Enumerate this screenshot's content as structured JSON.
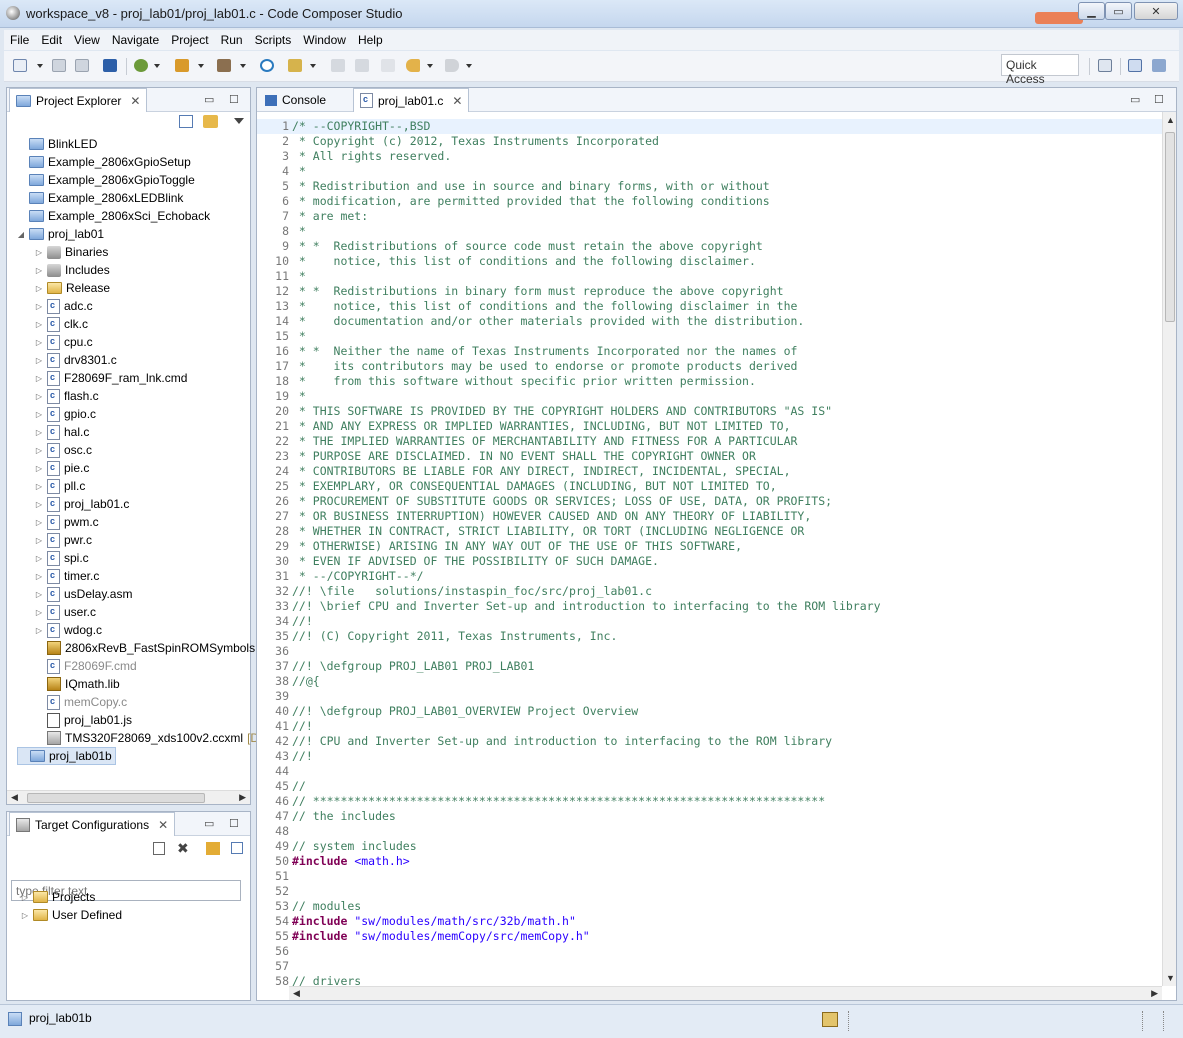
{
  "window": {
    "title": "workspace_v8 - proj_lab01/proj_lab01.c - Code Composer Studio"
  },
  "menubar": [
    "File",
    "Edit",
    "View",
    "Navigate",
    "Project",
    "Run",
    "Scripts",
    "Window",
    "Help"
  ],
  "toolbar": {
    "quick_access": "Quick Access"
  },
  "project_explorer": {
    "tab_label": "Project Explorer",
    "items": [
      {
        "label": "BlinkLED",
        "kind": "project",
        "level": 0,
        "expand": "",
        "extra": ""
      },
      {
        "label": "Example_2806xGpioSetup",
        "kind": "project",
        "level": 0,
        "expand": "",
        "extra": ""
      },
      {
        "label": "Example_2806xGpioToggle",
        "kind": "project",
        "level": 0,
        "expand": "",
        "extra": ""
      },
      {
        "label": "Example_2806xLEDBlink",
        "kind": "project",
        "level": 0,
        "expand": "",
        "extra": ""
      },
      {
        "label": "Example_2806xSci_Echoback",
        "kind": "project",
        "level": 0,
        "expand": "",
        "extra": ""
      },
      {
        "label": "proj_lab01",
        "kind": "project-open",
        "level": 0,
        "expand": "◢",
        "extra": ""
      },
      {
        "label": "Binaries",
        "kind": "binaries",
        "level": 1,
        "expand": "▷",
        "extra": ""
      },
      {
        "label": "Includes",
        "kind": "includes",
        "level": 1,
        "expand": "▷",
        "extra": ""
      },
      {
        "label": "Release",
        "kind": "folder",
        "level": 1,
        "expand": "▷",
        "extra": ""
      },
      {
        "label": "adc.c",
        "kind": "file",
        "level": 1,
        "expand": "▷",
        "extra": ""
      },
      {
        "label": "clk.c",
        "kind": "file",
        "level": 1,
        "expand": "▷",
        "extra": ""
      },
      {
        "label": "cpu.c",
        "kind": "file",
        "level": 1,
        "expand": "▷",
        "extra": ""
      },
      {
        "label": "drv8301.c",
        "kind": "file",
        "level": 1,
        "expand": "▷",
        "extra": ""
      },
      {
        "label": "F28069F_ram_lnk.cmd",
        "kind": "file",
        "level": 1,
        "expand": "▷",
        "extra": ""
      },
      {
        "label": "flash.c",
        "kind": "file",
        "level": 1,
        "expand": "▷",
        "extra": ""
      },
      {
        "label": "gpio.c",
        "kind": "file",
        "level": 1,
        "expand": "▷",
        "extra": ""
      },
      {
        "label": "hal.c",
        "kind": "file",
        "level": 1,
        "expand": "▷",
        "extra": ""
      },
      {
        "label": "osc.c",
        "kind": "file",
        "level": 1,
        "expand": "▷",
        "extra": ""
      },
      {
        "label": "pie.c",
        "kind": "file",
        "level": 1,
        "expand": "▷",
        "extra": ""
      },
      {
        "label": "pll.c",
        "kind": "file",
        "level": 1,
        "expand": "▷",
        "extra": ""
      },
      {
        "label": "proj_lab01.c",
        "kind": "file",
        "level": 1,
        "expand": "▷",
        "extra": ""
      },
      {
        "label": "pwm.c",
        "kind": "file",
        "level": 1,
        "expand": "▷",
        "extra": ""
      },
      {
        "label": "pwr.c",
        "kind": "file",
        "level": 1,
        "expand": "▷",
        "extra": ""
      },
      {
        "label": "spi.c",
        "kind": "file",
        "level": 1,
        "expand": "▷",
        "extra": ""
      },
      {
        "label": "timer.c",
        "kind": "file",
        "level": 1,
        "expand": "▷",
        "extra": ""
      },
      {
        "label": "usDelay.asm",
        "kind": "file",
        "level": 1,
        "expand": "▷",
        "extra": ""
      },
      {
        "label": "user.c",
        "kind": "file",
        "level": 1,
        "expand": "▷",
        "extra": ""
      },
      {
        "label": "wdog.c",
        "kind": "file",
        "level": 1,
        "expand": "▷",
        "extra": ""
      },
      {
        "label": "2806xRevB_FastSpinROMSymbols.",
        "kind": "lib",
        "level": 1,
        "expand": "",
        "extra": ""
      },
      {
        "label": "F28069F.cmd",
        "kind": "file-grey",
        "level": 1,
        "expand": "",
        "extra": ""
      },
      {
        "label": "IQmath.lib",
        "kind": "lib",
        "level": 1,
        "expand": "",
        "extra": ""
      },
      {
        "label": "memCopy.c",
        "kind": "file-grey",
        "level": 1,
        "expand": "",
        "extra": ""
      },
      {
        "label": "proj_lab01.js",
        "kind": "js",
        "level": 1,
        "expand": "",
        "extra": ""
      },
      {
        "label": "TMS320F28069_xds100v2.ccxml",
        "kind": "cfg",
        "level": 1,
        "expand": "",
        "extra": "[D"
      },
      {
        "label": "proj_lab01b",
        "kind": "project",
        "level": 0,
        "expand": "",
        "extra": "",
        "selected": true
      }
    ]
  },
  "target_configurations": {
    "tab_label": "Target Configurations",
    "filter_placeholder": "type filter text",
    "items": [
      {
        "label": "Projects",
        "expand": "▷"
      },
      {
        "label": "User Defined",
        "expand": "▷"
      }
    ]
  },
  "editor": {
    "tabs": [
      {
        "label": "Console",
        "active": false
      },
      {
        "label": "proj_lab01.c",
        "active": true
      }
    ],
    "lines": [
      {
        "n": "1",
        "t": "/* --COPYRIGHT--,BSD",
        "k": "comment"
      },
      {
        "n": "2",
        "t": " * Copyright (c) 2012, Texas Instruments Incorporated",
        "k": "comment"
      },
      {
        "n": "3",
        "t": " * All rights reserved.",
        "k": "comment"
      },
      {
        "n": "4",
        "t": " *",
        "k": "comment"
      },
      {
        "n": "5",
        "t": " * Redistribution and use in source and binary forms, with or without",
        "k": "comment"
      },
      {
        "n": "6",
        "t": " * modification, are permitted provided that the following conditions",
        "k": "comment"
      },
      {
        "n": "7",
        "t": " * are met:",
        "k": "comment"
      },
      {
        "n": "8",
        "t": " *",
        "k": "comment"
      },
      {
        "n": "9",
        "t": " * *  Redistributions of source code must retain the above copyright",
        "k": "comment"
      },
      {
        "n": "10",
        "t": " *    notice, this list of conditions and the following disclaimer.",
        "k": "comment"
      },
      {
        "n": "11",
        "t": " *",
        "k": "comment"
      },
      {
        "n": "12",
        "t": " * *  Redistributions in binary form must reproduce the above copyright",
        "k": "comment"
      },
      {
        "n": "13",
        "t": " *    notice, this list of conditions and the following disclaimer in the",
        "k": "comment"
      },
      {
        "n": "14",
        "t": " *    documentation and/or other materials provided with the distribution.",
        "k": "comment"
      },
      {
        "n": "15",
        "t": " *",
        "k": "comment"
      },
      {
        "n": "16",
        "t": " * *  Neither the name of Texas Instruments Incorporated nor the names of",
        "k": "comment"
      },
      {
        "n": "17",
        "t": " *    its contributors may be used to endorse or promote products derived",
        "k": "comment"
      },
      {
        "n": "18",
        "t": " *    from this software without specific prior written permission.",
        "k": "comment"
      },
      {
        "n": "19",
        "t": " *",
        "k": "comment"
      },
      {
        "n": "20",
        "t": " * THIS SOFTWARE IS PROVIDED BY THE COPYRIGHT HOLDERS AND CONTRIBUTORS \"AS IS\"",
        "k": "comment"
      },
      {
        "n": "21",
        "t": " * AND ANY EXPRESS OR IMPLIED WARRANTIES, INCLUDING, BUT NOT LIMITED TO,",
        "k": "comment"
      },
      {
        "n": "22",
        "t": " * THE IMPLIED WARRANTIES OF MERCHANTABILITY AND FITNESS FOR A PARTICULAR",
        "k": "comment"
      },
      {
        "n": "23",
        "t": " * PURPOSE ARE DISCLAIMED. IN NO EVENT SHALL THE COPYRIGHT OWNER OR",
        "k": "comment"
      },
      {
        "n": "24",
        "t": " * CONTRIBUTORS BE LIABLE FOR ANY DIRECT, INDIRECT, INCIDENTAL, SPECIAL,",
        "k": "comment"
      },
      {
        "n": "25",
        "t": " * EXEMPLARY, OR CONSEQUENTIAL DAMAGES (INCLUDING, BUT NOT LIMITED TO,",
        "k": "comment"
      },
      {
        "n": "26",
        "t": " * PROCUREMENT OF SUBSTITUTE GOODS OR SERVICES; LOSS OF USE, DATA, OR PROFITS;",
        "k": "comment"
      },
      {
        "n": "27",
        "t": " * OR BUSINESS INTERRUPTION) HOWEVER CAUSED AND ON ANY THEORY OF LIABILITY,",
        "k": "comment"
      },
      {
        "n": "28",
        "t": " * WHETHER IN CONTRACT, STRICT LIABILITY, OR TORT (INCLUDING NEGLIGENCE OR",
        "k": "comment"
      },
      {
        "n": "29",
        "t": " * OTHERWISE) ARISING IN ANY WAY OUT OF THE USE OF THIS SOFTWARE,",
        "k": "comment"
      },
      {
        "n": "30",
        "t": " * EVEN IF ADVISED OF THE POSSIBILITY OF SUCH DAMAGE.",
        "k": "comment"
      },
      {
        "n": "31",
        "t": " * --/COPYRIGHT--*/",
        "k": "comment"
      },
      {
        "n": "32",
        "t": "//! \\file   solutions/instaspin_foc/src/proj_lab01.c",
        "k": "comment"
      },
      {
        "n": "33",
        "t": "//! \\brief CPU and Inverter Set-up and introduction to interfacing to the ROM library",
        "k": "comment"
      },
      {
        "n": "34",
        "t": "//!",
        "k": "comment"
      },
      {
        "n": "35",
        "t": "//! (C) Copyright 2011, Texas Instruments, Inc.",
        "k": "comment"
      },
      {
        "n": "36",
        "t": "",
        "k": "plain"
      },
      {
        "n": "37",
        "t": "//! \\defgroup PROJ_LAB01 PROJ_LAB01",
        "k": "comment"
      },
      {
        "n": "38",
        "t": "//@{",
        "k": "comment"
      },
      {
        "n": "39",
        "t": "",
        "k": "plain"
      },
      {
        "n": "40",
        "t": "//! \\defgroup PROJ_LAB01_OVERVIEW Project Overview",
        "k": "comment"
      },
      {
        "n": "41",
        "t": "//!",
        "k": "comment"
      },
      {
        "n": "42",
        "t": "//! CPU and Inverter Set-up and introduction to interfacing to the ROM library",
        "k": "comment"
      },
      {
        "n": "43",
        "t": "//!",
        "k": "comment"
      },
      {
        "n": "44",
        "t": "",
        "k": "plain"
      },
      {
        "n": "45",
        "t": "//",
        "k": "comment"
      },
      {
        "n": "46",
        "t": "// **************************************************************************",
        "k": "comment"
      },
      {
        "n": "47",
        "t": "// the includes",
        "k": "comment"
      },
      {
        "n": "48",
        "t": "",
        "k": "plain"
      },
      {
        "n": "49",
        "t": "// system includes",
        "k": "comment"
      },
      {
        "n": "50",
        "t": "#include <math.h>",
        "k": "include"
      },
      {
        "n": "51",
        "t": "",
        "k": "plain"
      },
      {
        "n": "52",
        "t": "",
        "k": "plain"
      },
      {
        "n": "53",
        "t": "// modules",
        "k": "comment"
      },
      {
        "n": "54",
        "t": "#include \"sw/modules/math/src/32b/math.h\"",
        "k": "include"
      },
      {
        "n": "55",
        "t": "#include \"sw/modules/memCopy/src/memCopy.h\"",
        "k": "include"
      },
      {
        "n": "56",
        "t": "",
        "k": "plain"
      },
      {
        "n": "57",
        "t": "",
        "k": "plain"
      },
      {
        "n": "58",
        "t": "// drivers",
        "k": "comment"
      }
    ]
  },
  "statusbar": {
    "text": "proj_lab01b"
  },
  "colors": {
    "comment": "#3f7f5f",
    "directive": "#7f0055",
    "string": "#2a00ff",
    "selection": "#dae6f5"
  }
}
